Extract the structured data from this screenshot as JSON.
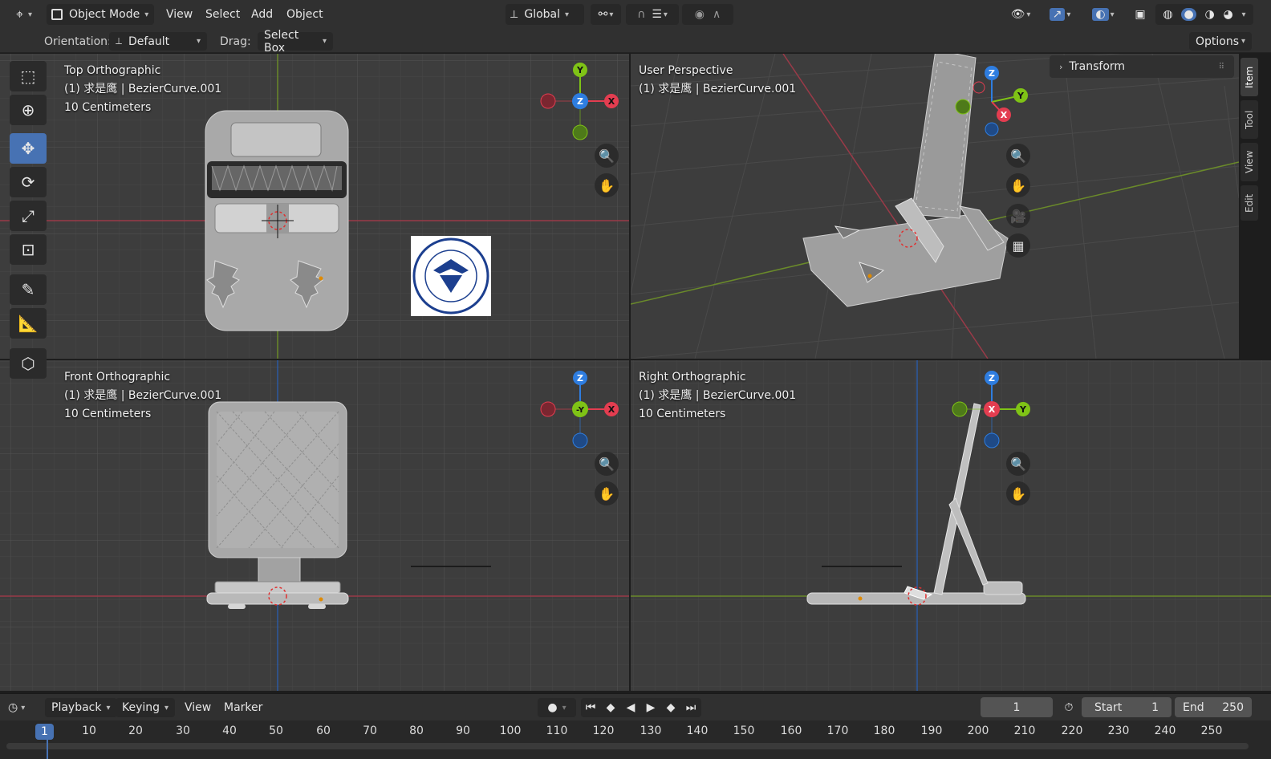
{
  "header": {
    "mode": "Object Mode",
    "menus": [
      "View",
      "Select",
      "Add",
      "Object"
    ],
    "transform_orientation": "Global",
    "options_label": "Options"
  },
  "tool_settings": {
    "orientation_label": "Orientation:",
    "orientation_value": "Default",
    "drag_label": "Drag:",
    "drag_value": "Select Box"
  },
  "viewports": [
    {
      "view": "Top Orthographic",
      "object": "(1) 求是鹰 | BezierCurve.001",
      "scale": "10 Centimeters",
      "gizmo": {
        "top": "Y",
        "center": "Z",
        "right": "X"
      }
    },
    {
      "view": "User Perspective",
      "object": "(1) 求是鹰 | BezierCurve.001",
      "gizmo": {
        "top": "Z",
        "right": "Y",
        "bottom": "X"
      }
    },
    {
      "view": "Front Orthographic",
      "object": "(1) 求是鹰 | BezierCurve.001",
      "scale": "10 Centimeters",
      "gizmo": {
        "top": "Z",
        "center": "-Y",
        "right": "X"
      }
    },
    {
      "view": "Right Orthographic",
      "object": "(1) 求是鹰 | BezierCurve.001",
      "scale": "10 Centimeters",
      "gizmo": {
        "top": "Z",
        "center": "X",
        "right": "Y"
      }
    }
  ],
  "sidebar": {
    "panel_title": "Transform",
    "tabs": [
      "Item",
      "Tool",
      "View",
      "Edit"
    ]
  },
  "logo_text": "ZHEJIANG UNIVERSITY",
  "logo_year": "1897",
  "timeline": {
    "menus": [
      "Playback",
      "Keying",
      "View",
      "Marker"
    ],
    "current_frame": "1",
    "start_label": "Start",
    "start_value": "1",
    "end_label": "End",
    "end_value": "250",
    "ruler": [
      "1",
      "10",
      "20",
      "30",
      "40",
      "50",
      "60",
      "70",
      "80",
      "90",
      "100",
      "110",
      "120",
      "130",
      "140",
      "150",
      "160",
      "170",
      "180",
      "190",
      "200",
      "210",
      "220",
      "230",
      "240",
      "250"
    ]
  },
  "colors": {
    "accent": "#4772b3",
    "x_axis": "#e33d50",
    "y_axis": "#7fc316",
    "z_axis": "#2e7de0"
  }
}
